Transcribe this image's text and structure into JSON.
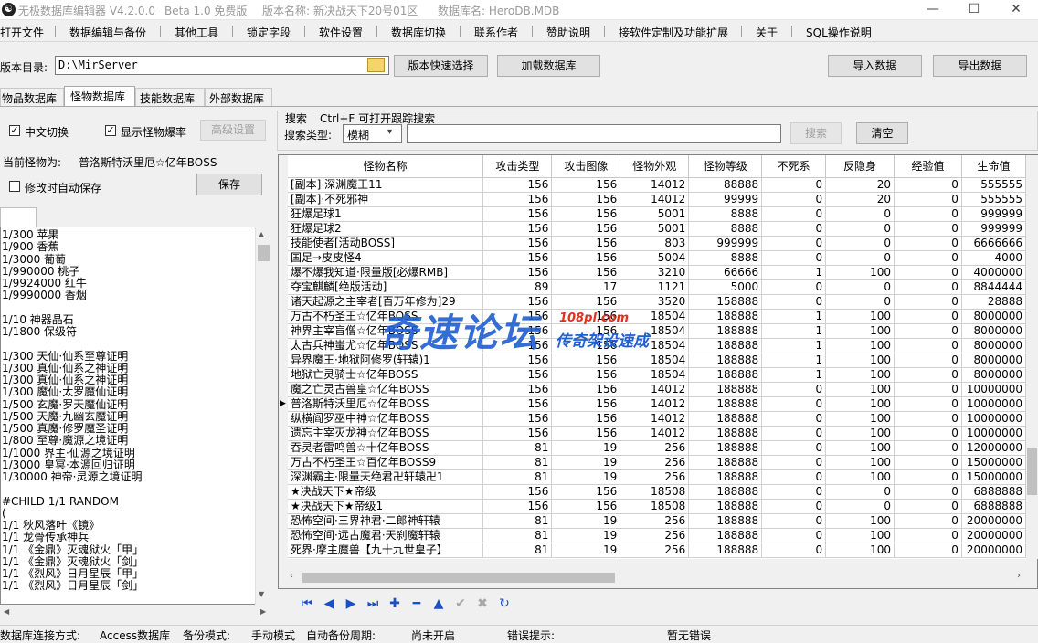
{
  "titlebar": {
    "app_title": "无极数据库编辑器 V4.2.0.0",
    "edition": "Beta 1.0 免费版",
    "version_name": "版本名称: 新决战天下20号01区",
    "db_name": "数据库名: HeroDB.MDB",
    "minimize": "—",
    "maximize": "☐",
    "close": "✕"
  },
  "menu": [
    "打开文件",
    "数据编辑与备份",
    "其他工具",
    "锁定字段",
    "软件设置",
    "数据库切换",
    "联系作者",
    "赞助说明",
    "接软件定制及功能扩展",
    "关于",
    "SQL操作说明"
  ],
  "toolbar": {
    "dir_label": "版本目录:",
    "dir_value": "D:\\MirServer",
    "quick_select": "版本快速选择",
    "load_db": "加载数据库",
    "import": "导入数据",
    "export": "导出数据"
  },
  "tabs": [
    "物品数据库",
    "怪物数据库",
    "技能数据库",
    "外部数据库"
  ],
  "active_tab": 1,
  "options": {
    "chinese_switch": "中文切换",
    "show_drop": "显示怪物爆率",
    "advanced": "高级设置",
    "current_monster_label": "当前怪物为:",
    "current_monster": "普洛斯特沃里厄☆亿年BOSS",
    "auto_save": "修改时自动保存",
    "save": "保存"
  },
  "search": {
    "title": "搜索",
    "hint": "Ctrl+F 可打开跟踪搜索",
    "type_label": "搜索类型:",
    "type_value": "模糊",
    "search_btn": "搜索",
    "clear_btn": "清空"
  },
  "drop_list": [
    "1/300 苹果",
    "1/900 香蕉",
    "1/3000 葡萄",
    "1/990000 桃子",
    "1/9924000 红牛",
    "1/9990000 香烟",
    "",
    "1/10 神器晶石",
    "1/1800 保级符",
    "",
    "1/300 天仙·仙系至尊证明",
    "1/300 真仙·仙系之神证明",
    "1/300 真仙·仙系之神证明",
    "1/300 魔仙·太罗魔仙证明",
    "1/500 玄魔·罗天魔仙证明",
    "1/500 天魔·九幽玄魔证明",
    "1/500 真魔·修罗魔圣证明",
    "1/800 至尊·魔源之境证明",
    "1/1000 界主·仙源之境证明",
    "1/3000 皇冥·本源回归证明",
    "1/30000 神帝·灵源之境证明",
    "",
    "#CHILD 1/1 RANDOM",
    "(",
    "1/1 秋风落叶《镜》",
    "1/1 龙骨传承神兵",
    "1/1 《金鼎》灭魂狱火「甲」",
    "1/1 《金鼎》灭魂狱火「剑」",
    "1/1 《烈风》日月星辰「甲」",
    "1/1 《烈风》日月星辰「剑」"
  ],
  "grid": {
    "columns": [
      "怪物名称",
      "攻击类型",
      "攻击图像",
      "怪物外观",
      "怪物等级",
      "不死系",
      "反隐身",
      "经验值",
      "生命值"
    ],
    "rows": [
      [
        "[副本]·深渊魔王11",
        "156",
        "156",
        "14012",
        "88888",
        "0",
        "20",
        "0",
        "555555"
      ],
      [
        "[副本]·不死邪神",
        "156",
        "156",
        "14012",
        "99999",
        "0",
        "20",
        "0",
        "555555"
      ],
      [
        "狂爆足球1",
        "156",
        "156",
        "5001",
        "8888",
        "0",
        "0",
        "0",
        "999999"
      ],
      [
        "狂爆足球2",
        "156",
        "156",
        "5001",
        "8888",
        "0",
        "0",
        "0",
        "999999"
      ],
      [
        "技能使者[活动BOSS]",
        "156",
        "156",
        "803",
        "999999",
        "0",
        "0",
        "0",
        "6666666"
      ],
      [
        "国足→皮皮怪4",
        "156",
        "156",
        "5004",
        "8888",
        "0",
        "0",
        "0",
        "4000"
      ],
      [
        "爆不爆我知道·限量版[必爆RMB]",
        "156",
        "156",
        "3210",
        "66666",
        "1",
        "100",
        "0",
        "4000000"
      ],
      [
        "夺宝麒麟[绝版活动]",
        "89",
        "17",
        "1121",
        "5000",
        "0",
        "0",
        "0",
        "8844444"
      ],
      [
        "诸天起源之主宰者[百万年修为]29",
        "156",
        "156",
        "3520",
        "158888",
        "0",
        "0",
        "0",
        "28888"
      ],
      [
        "万古不朽圣王☆亿年BOSS",
        "156",
        "156",
        "18504",
        "188888",
        "1",
        "100",
        "0",
        "8000000"
      ],
      [
        "神界主宰盲僧☆亿年BOSS",
        "156",
        "156",
        "18504",
        "188888",
        "1",
        "100",
        "0",
        "8000000"
      ],
      [
        "太古兵神蚩尤☆亿年BOSS",
        "156",
        "156",
        "18504",
        "188888",
        "1",
        "100",
        "0",
        "8000000"
      ],
      [
        "异界魔王·地狱阿修罗(轩辕)1",
        "156",
        "156",
        "18504",
        "188888",
        "1",
        "100",
        "0",
        "8000000"
      ],
      [
        "地狱亡灵骑士☆亿年BOSS",
        "156",
        "156",
        "18504",
        "188888",
        "1",
        "100",
        "0",
        "8000000"
      ],
      [
        "魔之亡灵古兽皇☆亿年BOSS",
        "156",
        "156",
        "14012",
        "188888",
        "0",
        "100",
        "0",
        "10000000"
      ],
      [
        "普洛斯特沃里厄☆亿年BOSS",
        "156",
        "156",
        "14012",
        "188888",
        "0",
        "100",
        "0",
        "10000000"
      ],
      [
        "纵横阎罗巫中神☆亿年BOSS",
        "156",
        "156",
        "14012",
        "188888",
        "0",
        "100",
        "0",
        "10000000"
      ],
      [
        "遗忘主宰灭龙神☆亿年BOSS",
        "156",
        "156",
        "14012",
        "188888",
        "0",
        "100",
        "0",
        "10000000"
      ],
      [
        "吞灵者雷鸣兽☆十亿年BOSS",
        "81",
        "19",
        "256",
        "188888",
        "0",
        "100",
        "0",
        "12000000"
      ],
      [
        "万古不朽圣王☆百亿年BOSS9",
        "81",
        "19",
        "256",
        "188888",
        "0",
        "100",
        "0",
        "15000000"
      ],
      [
        "深渊霸主·限量天绝君卍轩辕卍1",
        "81",
        "19",
        "256",
        "188888",
        "0",
        "100",
        "0",
        "15000000"
      ],
      [
        "★决战天下★帝级",
        "156",
        "156",
        "18508",
        "188888",
        "0",
        "0",
        "0",
        "6888888"
      ],
      [
        "★决战天下★帝级1",
        "156",
        "156",
        "18508",
        "188888",
        "0",
        "0",
        "0",
        "6888888"
      ],
      [
        "恐怖空间·三界神君·二郎神轩辕",
        "81",
        "19",
        "256",
        "188888",
        "0",
        "100",
        "0",
        "20000000"
      ],
      [
        "恐怖空间·远古魔君·天刹魔轩辕",
        "81",
        "19",
        "256",
        "188888",
        "0",
        "100",
        "0",
        "20000000"
      ],
      [
        "死界·摩主魔兽【九十九世皇子】",
        "81",
        "19",
        "256",
        "188888",
        "0",
        "100",
        "0",
        "20000000"
      ]
    ],
    "current_row": 15
  },
  "nav": [
    "⏮",
    "◀",
    "▶",
    "⏭",
    "✚",
    "━",
    "▲",
    "✔",
    "✖",
    "↻"
  ],
  "status": {
    "conn_label": "数据库连接方式:",
    "conn_value": "Access数据库",
    "backup_label": "备份模式:",
    "backup_value": "手动模式",
    "auto_label": "自动备份周期:",
    "auto_value": "尚未开启",
    "err_label": "错误提示:",
    "err_value": "暂无错误"
  },
  "watermark": {
    "main": "奇速论坛",
    "domain": "108pl.com",
    "tagline": "传奇架设速成"
  },
  "colors": {
    "nav_blue": "#1a4fc8",
    "watermark_blue": "#1f5fd0",
    "watermark_red": "#e03020"
  }
}
